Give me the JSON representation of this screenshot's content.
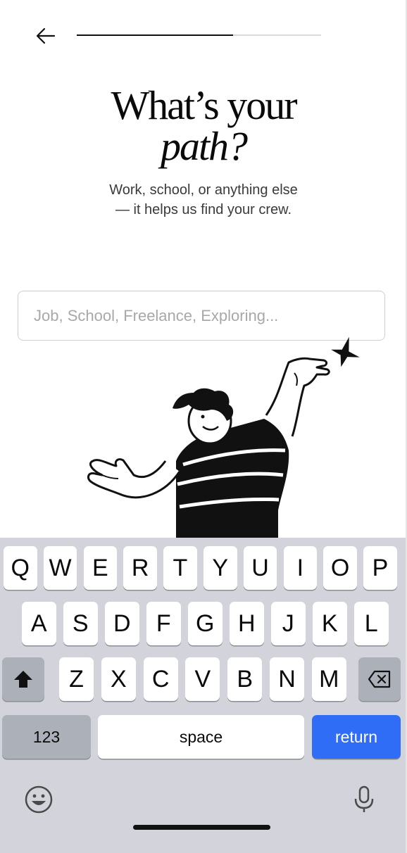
{
  "header": {
    "progress_fraction": 0.64
  },
  "title": {
    "line1": "What’s your",
    "line2": "path?"
  },
  "subtitle": "Work, school, or anything else — it helps us find your crew.",
  "path_input": {
    "value": "",
    "placeholder": "Job, School, Freelance, Exploring..."
  },
  "keyboard": {
    "row1": [
      "Q",
      "W",
      "E",
      "R",
      "T",
      "Y",
      "U",
      "I",
      "O",
      "P"
    ],
    "row2": [
      "A",
      "S",
      "D",
      "F",
      "G",
      "H",
      "J",
      "K",
      "L"
    ],
    "row3": [
      "Z",
      "X",
      "C",
      "V",
      "B",
      "N",
      "M"
    ],
    "numbers_label": "123",
    "space_label": "space",
    "return_label": "return",
    "return_color": "#2f6df6",
    "icons": [
      "shift-icon",
      "backspace-icon",
      "emoji-icon",
      "microphone-icon"
    ]
  }
}
